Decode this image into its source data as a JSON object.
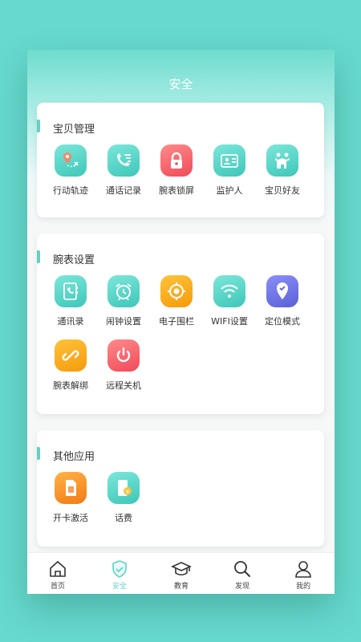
{
  "page": {
    "title": "安全"
  },
  "sections": {
    "baby": {
      "title": "宝贝管理",
      "items": [
        {
          "label": "行动轨迹",
          "icon": "route-pin-icon"
        },
        {
          "label": "通话记录",
          "icon": "phone-list-icon"
        },
        {
          "label": "腕表锁屏",
          "icon": "lock-icon"
        },
        {
          "label": "监护人",
          "icon": "id-card-icon"
        },
        {
          "label": "宝贝好友",
          "icon": "friends-icon"
        }
      ]
    },
    "watch": {
      "title": "腕表设置",
      "items": [
        {
          "label": "通讯录",
          "icon": "contacts-book-icon"
        },
        {
          "label": "闹钟设置",
          "icon": "alarm-clock-icon"
        },
        {
          "label": "电子围栏",
          "icon": "geofence-icon"
        },
        {
          "label": "WIFI设置",
          "icon": "wifi-icon"
        },
        {
          "label": "定位模式",
          "icon": "location-mode-icon"
        },
        {
          "label": "腕表解绑",
          "icon": "unlink-icon"
        },
        {
          "label": "远程关机",
          "icon": "power-icon"
        }
      ]
    },
    "other": {
      "title": "其他应用",
      "items": [
        {
          "label": "开卡激活",
          "icon": "sim-card-icon"
        },
        {
          "label": "话费",
          "icon": "phone-bill-icon"
        }
      ]
    }
  },
  "tabbar": {
    "items": [
      {
        "label": "首页",
        "icon": "home-icon"
      },
      {
        "label": "安全",
        "icon": "shield-check-icon",
        "active": true
      },
      {
        "label": "教育",
        "icon": "graduation-cap-icon"
      },
      {
        "label": "发现",
        "icon": "search-icon"
      },
      {
        "label": "我的",
        "icon": "user-icon"
      }
    ]
  },
  "colors": {
    "accent": "#5fd3c5",
    "background": "#67dacd",
    "lock_red": "#ef4b58",
    "fence_orange": "#f59b0b",
    "location_purple": "#5a5fd6"
  }
}
